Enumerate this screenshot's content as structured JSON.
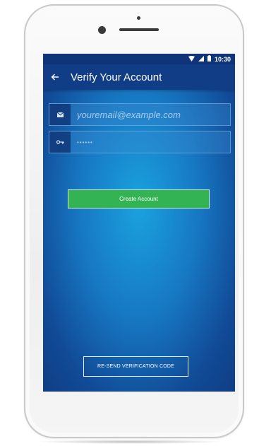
{
  "status_bar": {
    "time": "10:30",
    "icons": [
      "wifi-icon",
      "signal-icon",
      "battery-icon"
    ]
  },
  "app_bar": {
    "back_icon": "arrow-left-icon",
    "title": "Verify Your Account"
  },
  "form": {
    "email": {
      "icon": "envelope-icon",
      "placeholder": "youremail@example.com",
      "value": ""
    },
    "password": {
      "icon": "key-icon",
      "placeholder": "••••••",
      "value": ""
    },
    "create_button_label": "Create Account",
    "resend_button_label": "RE-SEND VERIFICATION CODE"
  },
  "colors": {
    "app_bar": "#113d87",
    "accent_green": "#34b355",
    "screen_center": "#1aa2df",
    "screen_edge": "#0f3f86"
  }
}
